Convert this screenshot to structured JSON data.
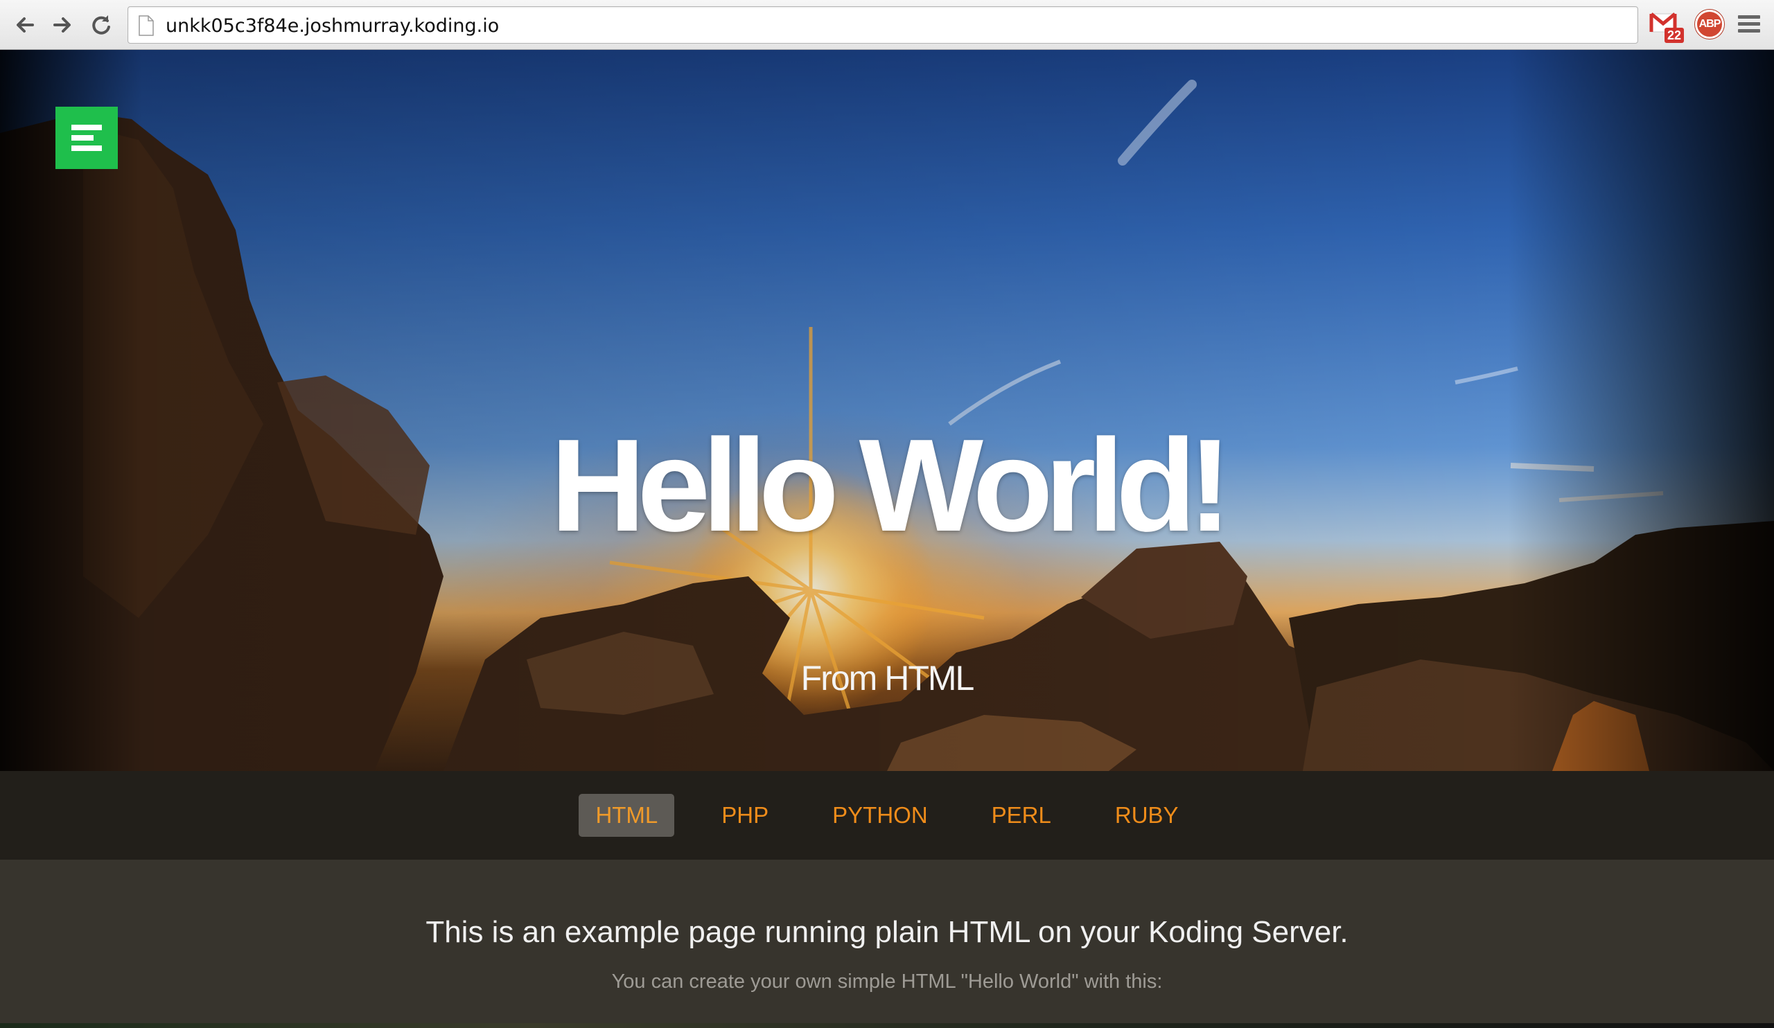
{
  "browser": {
    "url": "unkk05c3f84e.joshmurray.koding.io",
    "back_icon": "back-arrow-icon",
    "forward_icon": "forward-arrow-icon",
    "reload_icon": "reload-icon",
    "extensions": {
      "gmail_badge": "22",
      "abp_label": "ABP"
    }
  },
  "hero": {
    "title": "Hello World!",
    "subtitle": "From HTML",
    "menu_button_color": "#1fbf4c"
  },
  "tabs": {
    "items": [
      {
        "label": "HTML",
        "active": true
      },
      {
        "label": "PHP",
        "active": false
      },
      {
        "label": "PYTHON",
        "active": false
      },
      {
        "label": "PERL",
        "active": false
      },
      {
        "label": "RUBY",
        "active": false
      }
    ],
    "accent_color": "#ef8c1a"
  },
  "content": {
    "heading": "This is an example page running plain HTML on your Koding Server.",
    "text": "You can create your own simple HTML \"Hello World\" with this:"
  }
}
